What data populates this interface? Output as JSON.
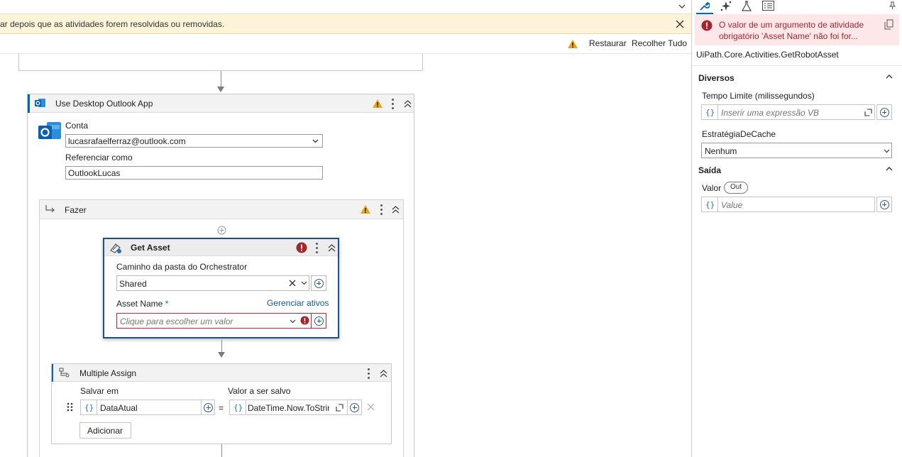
{
  "canvas": {
    "warning_bar": {
      "text": "ar depois que as atividades forem resolvidas ou removidas."
    },
    "toolbar": {
      "restore_label": "Restaurar",
      "collapse_all_label": "Recolher Tudo"
    },
    "outlook_scope": {
      "title": "Use Desktop Outlook App",
      "account_label": "Conta",
      "account_value": "lucasrafaelferraz@outlook.com",
      "reference_label": "Referenciar como",
      "reference_value": "OutlookLucas"
    },
    "do_sequence": {
      "title": "Fazer"
    },
    "get_asset": {
      "title": "Get Asset",
      "folder_label": "Caminho da pasta do Orchestrator",
      "folder_value": "Shared",
      "asset_name_label": "Asset Name",
      "required_mark": "*",
      "manage_link": "Gerenciar ativos",
      "asset_placeholder": "Clique para escolher um valor"
    },
    "multiple_assign": {
      "title": "Multiple Assign",
      "save_in_label": "Salvar em",
      "value_label": "Valor a ser salvo",
      "braces": "{}",
      "variable": "DataAtual",
      "equals": "=",
      "expression": "DateTime.Now.ToStrin",
      "add_button": "Adicionar"
    }
  },
  "properties": {
    "error_message": "O valor de um argumento de atividade obrigatório 'Asset Name' não foi for...",
    "activity_type": "UiPath.Core.Activities.GetRobotAsset",
    "section_misc": "Diversos",
    "timeout_label": "Tempo Limite (milissegundos)",
    "timeout_placeholder": "Inserir uma expressão VB",
    "cache_label": "EstratégiaDeCache",
    "cache_value": "Nenhum",
    "section_output": "Saída",
    "value_label": "Valor",
    "out_badge": "Out",
    "value_placeholder": "Value",
    "braces": "{}"
  },
  "colors": {
    "accent": "#0067b8",
    "error": "#a4262c",
    "warning": "#e8a317",
    "selection_border": "#1f4e8c"
  }
}
